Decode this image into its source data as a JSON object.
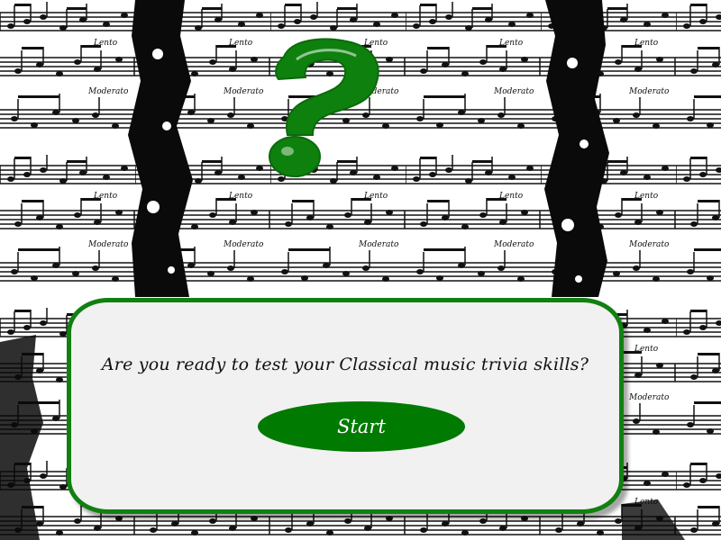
{
  "dialog": {
    "prompt": "Are you ready to test your Classical music trivia skills?",
    "start_label": "Start"
  },
  "background": {
    "tile_labels": [
      "Lento",
      "Moderato"
    ]
  },
  "colors": {
    "accent": "#118011",
    "button": "#007a00",
    "logo": "#0e800e",
    "panel": "#f1f1f1",
    "ink": "#111111"
  },
  "icons": {
    "logo": "question-mark-icon"
  }
}
